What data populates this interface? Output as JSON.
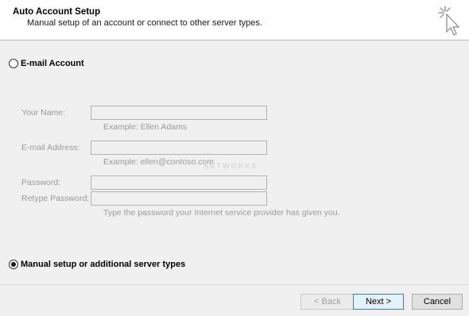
{
  "header": {
    "title": "Auto Account Setup",
    "subtitle": "Manual setup of an account or connect to other server types.",
    "icon": "wizard-cursor-icon"
  },
  "email_account": {
    "label": "E-mail Account",
    "checked": false,
    "fields": {
      "your_name": {
        "label": "Your Name:",
        "value": "",
        "example": "Example: Ellen Adams"
      },
      "email_address": {
        "label": "E-mail Address:",
        "value": "",
        "example": "Example: ellen@contoso.com"
      },
      "password": {
        "label": "Password:",
        "value": ""
      },
      "retype_password": {
        "label": "Retype Password:",
        "value": ""
      },
      "password_hint": "Type the password your Internet service provider has given you."
    }
  },
  "manual_setup": {
    "label": "Manual setup or additional server types",
    "checked": true
  },
  "watermark": "NETWORKS",
  "footer": {
    "back_label": "< Back",
    "next_label": "Next >",
    "cancel_label": "Cancel"
  }
}
